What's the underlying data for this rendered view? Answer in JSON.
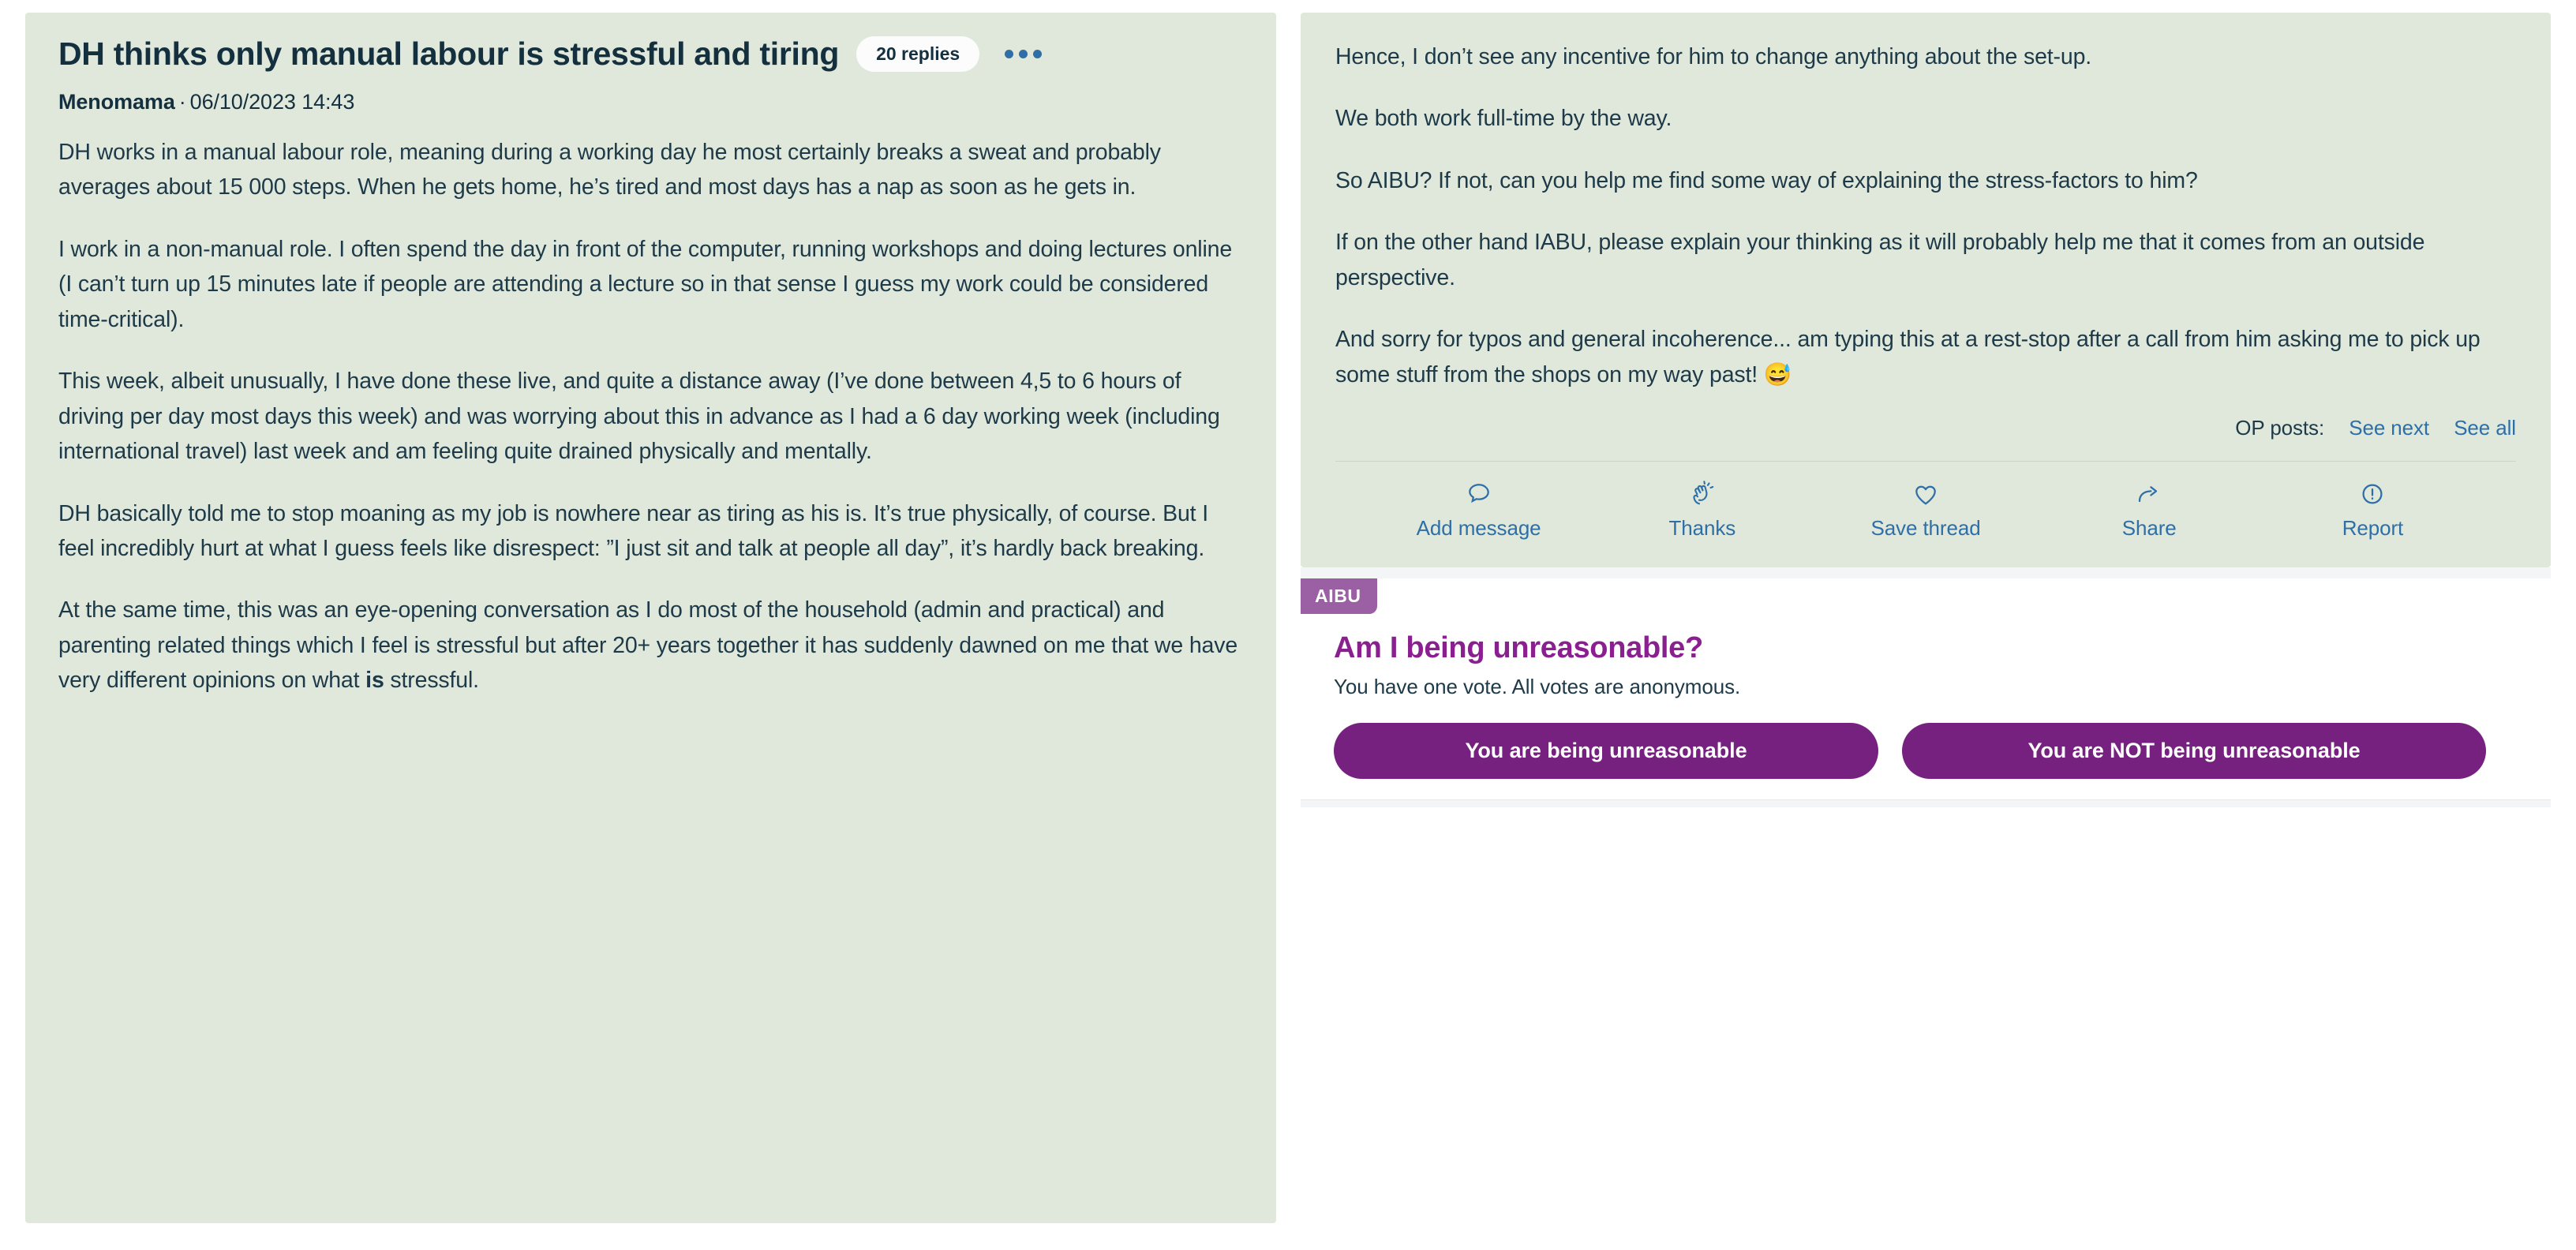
{
  "thread": {
    "title": "DH thinks only manual labour is stressful and tiring",
    "replies_badge": "20 replies",
    "more_menu": "…",
    "author": "Menomama",
    "separator": "·",
    "timestamp": "06/10/2023 14:43",
    "body_left": [
      "DH works in a manual labour role, meaning during a working day he most certainly breaks a sweat and probably averages about 15 000 steps. When he gets home, he’s tired and most days has a nap as soon as he gets in.",
      "I work in a non-manual role. I often spend the day in front of the computer, running workshops and doing lectures online (I can’t turn up 15 minutes late if people are attending a lecture so in that sense I guess my work could be considered time-critical).",
      "This week, albeit unusually, I have done these live, and quite a distance away (I’ve done between 4,5 to 6 hours of driving per day most days this week) and was worrying about this in advance as I had a 6 day working week (including international travel) last week and am feeling quite drained physically and mentally.",
      "DH basically told me to stop moaning as my job is nowhere near as tiring as his is. It’s true physically, of course. But I feel incredibly hurt at what I guess feels like disrespect: ”I just sit and talk at people all day”, it’s hardly back breaking."
    ],
    "body_left_last_prefix": "At the same time, this was an eye-opening conversation as I do most of the household (admin and practical) and parenting related things which I feel is stressful but after 20+ years together it has suddenly dawned on me that we have very different opinions on what ",
    "body_left_last_bold": "is",
    "body_left_last_suffix": " stressful.",
    "body_right": [
      "Hence, I don’t see any incentive for him to change anything about the set-up.",
      "We both work full-time by the way.",
      "So AIBU? If not, can you help me find some way of explaining the stress-factors to him?",
      "If on the other hand IABU, please explain your thinking as it will probably help me that it comes from an outside perspective.",
      "And sorry for typos and general incoherence... am typing this at a rest-stop after a call from him asking me to pick up some stuff from the shops on my way past! 😅"
    ]
  },
  "op_posts": {
    "label": "OP posts:",
    "see_next": "See next",
    "see_all": "See all"
  },
  "actions": [
    {
      "label": "Add message",
      "icon": "speech-bubble-icon"
    },
    {
      "label": "Thanks",
      "icon": "clapping-hands-icon"
    },
    {
      "label": "Save thread",
      "icon": "heart-icon"
    },
    {
      "label": "Share",
      "icon": "share-arrow-icon"
    },
    {
      "label": "Report",
      "icon": "exclamation-circle-icon"
    }
  ],
  "aibu": {
    "badge": "AIBU",
    "title": "Am I being unreasonable?",
    "subtitle": "You have one vote. All votes are anonymous.",
    "vote_yes": "You are being unreasonable",
    "vote_no": "You are NOT being unreasonable"
  },
  "colors": {
    "panel_green": "#dfe8db",
    "link_blue": "#2e6fa8",
    "text_dark": "#1e3a48",
    "badge_purple": "#9b5fa3",
    "button_purple": "#76217f",
    "heading_purple": "#8a1f8f"
  }
}
